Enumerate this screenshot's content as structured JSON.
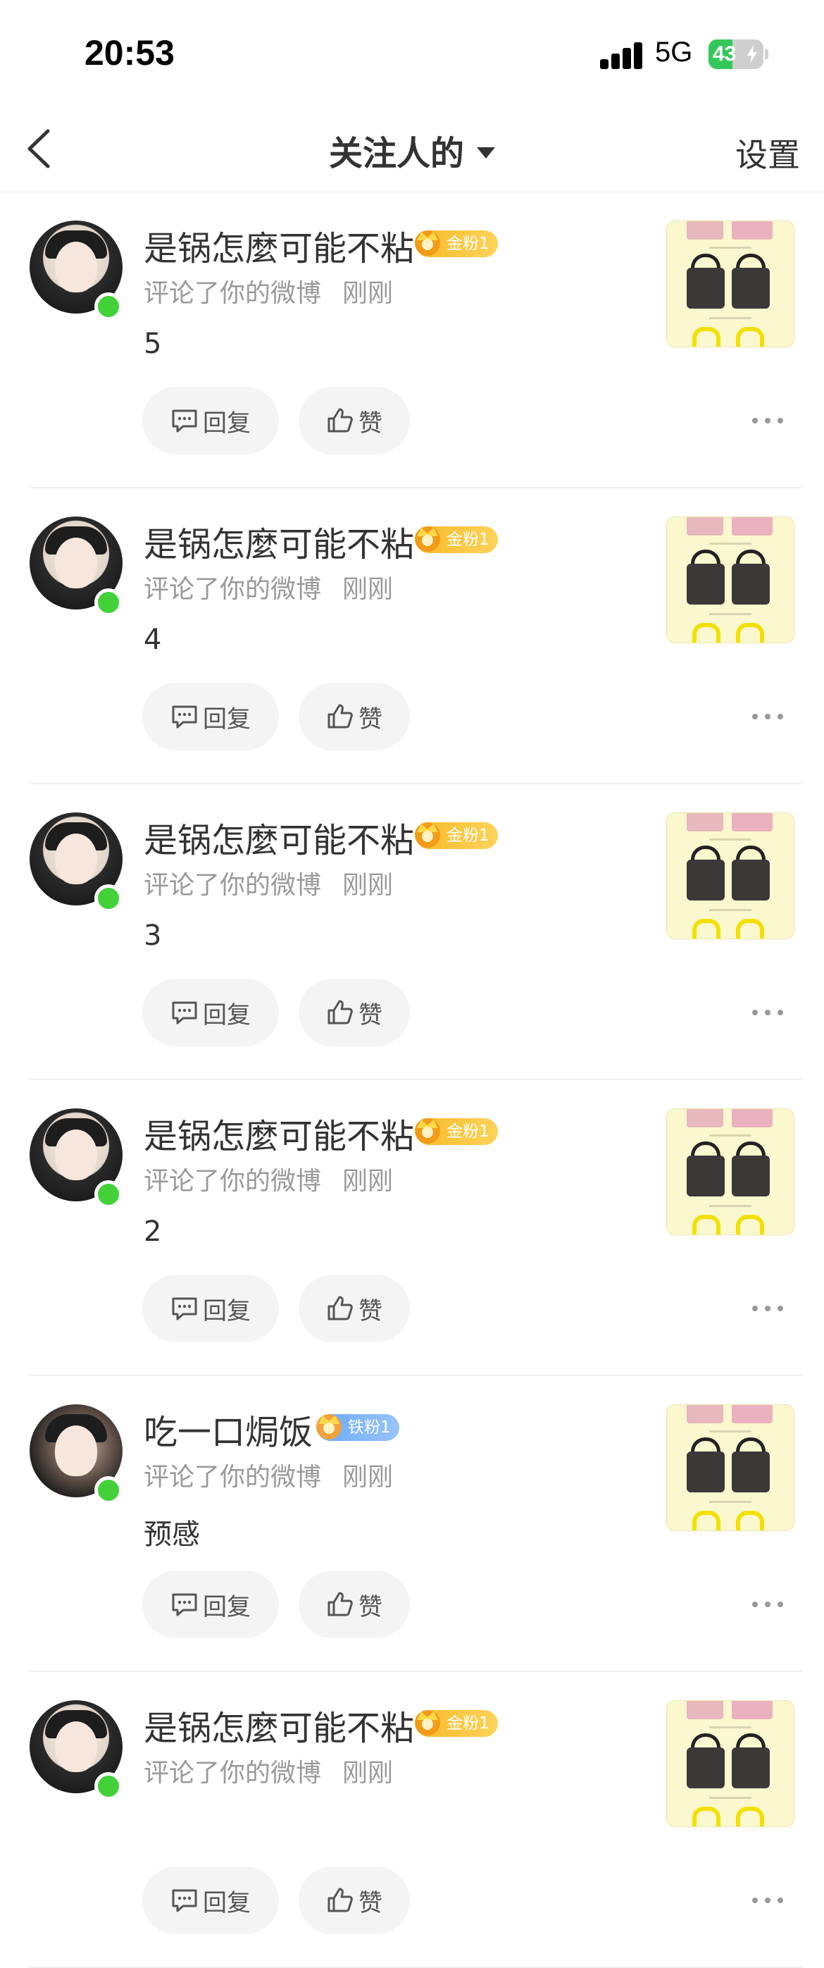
{
  "status_bar": {
    "time": "20:53",
    "network": "5G",
    "battery_level": "43",
    "battery_fraction": 0.43,
    "charging": true,
    "colors": {
      "battery_fill": "#34c759"
    }
  },
  "nav": {
    "title": "关注人的",
    "settings_label": "设置",
    "back_icon": "chevron-left-icon",
    "dropdown_icon": "caret-down-icon"
  },
  "actions": {
    "reply_label": "回复",
    "like_label": "赞",
    "more_icon": "more-horizontal-icon"
  },
  "notifications": [
    {
      "user": "是锅怎麼可能不粘",
      "badge": "金粉1",
      "badge_type": "gold",
      "action": "评论了你的微博",
      "time": "刚刚",
      "comment": "5",
      "online": true
    },
    {
      "user": "是锅怎麼可能不粘",
      "badge": "金粉1",
      "badge_type": "gold",
      "action": "评论了你的微博",
      "time": "刚刚",
      "comment": "4",
      "online": true
    },
    {
      "user": "是锅怎麼可能不粘",
      "badge": "金粉1",
      "badge_type": "gold",
      "action": "评论了你的微博",
      "time": "刚刚",
      "comment": "3",
      "online": true
    },
    {
      "user": "是锅怎麼可能不粘",
      "badge": "金粉1",
      "badge_type": "gold",
      "action": "评论了你的微博",
      "time": "刚刚",
      "comment": "2",
      "online": true
    },
    {
      "user": "吃一口焗饭",
      "badge": "铁粉1",
      "badge_type": "iron",
      "action": "评论了你的微博",
      "time": "刚刚",
      "comment": "预感",
      "online": true
    },
    {
      "user": "是锅怎麼可能不粘",
      "badge": "金粉1",
      "badge_type": "gold",
      "action": "评论了你的微博",
      "time": "刚刚",
      "comment": "",
      "online": true
    }
  ],
  "colors": {
    "online_dot": "#43d13a",
    "gold_badge": "#f7b928",
    "iron_badge": "#6aa8f5",
    "meta_text": "#9a9a9a"
  }
}
